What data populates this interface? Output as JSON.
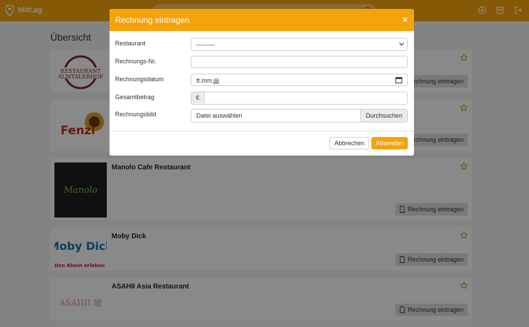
{
  "navbar": {
    "brand": "Mitt.ag",
    "icons": [
      "add-circle-icon",
      "archive-icon",
      "logout-icon"
    ]
  },
  "main": {
    "title": "Übersicht",
    "restaurants": [
      {
        "name": "",
        "logo": "RESTAURANT ALMTALERHOF",
        "button": "Rechnung eintragen"
      },
      {
        "name": "",
        "logo": "Fenzl",
        "button": "Rechnung eintragen"
      },
      {
        "name": "Manolo Cafe Restaurant",
        "logo": "Manolo",
        "button": "Rechnung eintragen"
      },
      {
        "name": "Moby Dick",
        "logo": "Moby Dick",
        "logo_sub": "Den Rhein erleben ...",
        "button": "Rechnung eintragen"
      },
      {
        "name": "ASAHII Asia Restaurant",
        "logo": "ASAHII 旭",
        "button": "Rechnung eintragen"
      }
    ]
  },
  "modal": {
    "title": "Rechnung eintragen",
    "close": "×",
    "fields": {
      "restaurant_label": "Restaurant",
      "restaurant_value": "---------",
      "invoice_no_label": "Rechnungs-Nr.",
      "invoice_date_label": "Rechnungsdatum",
      "invoice_date_value": "tt.mm.jjjj",
      "total_label": "Gesamtbetrag",
      "currency": "€",
      "image_label": "Rechnungsbild",
      "file_placeholder": "Datei auswählen",
      "browse": "Durchsuchen"
    },
    "cancel": "Abbrechen",
    "submit": "Absenden"
  },
  "colors": {
    "accent": "#f5a30b",
    "overlay": "rgba(0,0,0,0.45)"
  }
}
